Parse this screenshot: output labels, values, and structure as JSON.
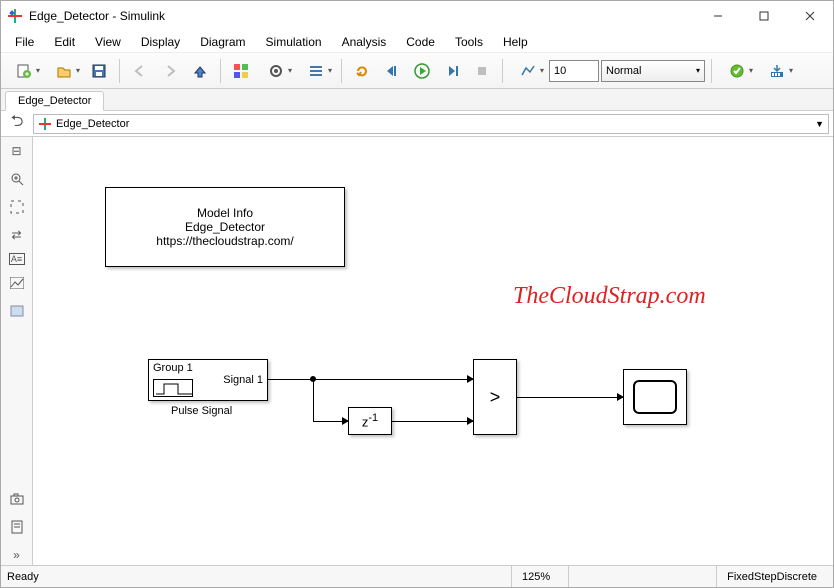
{
  "window": {
    "title": "Edge_Detector - Simulink"
  },
  "menu": {
    "items": [
      "File",
      "Edit",
      "View",
      "Display",
      "Diagram",
      "Simulation",
      "Analysis",
      "Code",
      "Tools",
      "Help"
    ]
  },
  "toolbar": {
    "sim_time": "10",
    "sim_mode": "Normal"
  },
  "tab": {
    "label": "Edge_Detector"
  },
  "breadcrumb": {
    "model": "Edge_Detector"
  },
  "modelinfo": {
    "line1": "Model Info",
    "line2": "Edge_Detector",
    "line3": "https://thecloudstrap.com/"
  },
  "watermark": "TheCloudStrap.com",
  "blocks": {
    "siggen_group": "Group 1",
    "siggen_signal": "Signal 1",
    "siggen_label": "Pulse Signal",
    "delay_label": "z",
    "delay_exp": "-1",
    "compare_op": ">"
  },
  "status": {
    "ready": "Ready",
    "zoom": "125%",
    "solver": "FixedStepDiscrete"
  }
}
